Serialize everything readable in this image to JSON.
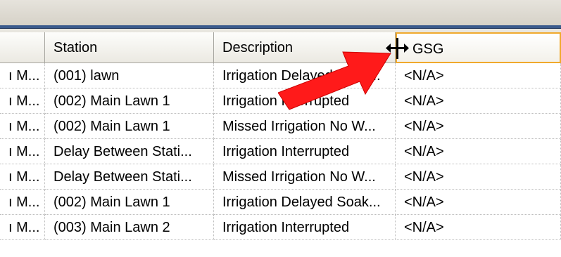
{
  "columns": {
    "col0": "",
    "station": "Station",
    "description": "Description",
    "gsg": "GSG"
  },
  "rows": [
    {
      "c0": "ı M...",
      "station": "(001) lawn",
      "description": "Irrigation Delayed Soak...",
      "gsg": "<N/A>"
    },
    {
      "c0": "ı M...",
      "station": "(002) Main Lawn 1",
      "description": "Irrigation Interrupted",
      "gsg": "<N/A>"
    },
    {
      "c0": "ı M...",
      "station": "(002) Main Lawn 1",
      "description": "Missed Irrigation No W...",
      "gsg": "<N/A>"
    },
    {
      "c0": "ı M...",
      "station": "Delay Between Stati...",
      "description": "Irrigation Interrupted",
      "gsg": "<N/A>"
    },
    {
      "c0": "ı M...",
      "station": "Delay Between Stati...",
      "description": "Missed Irrigation No W...",
      "gsg": "<N/A>"
    },
    {
      "c0": "ı M...",
      "station": "(002) Main Lawn 1",
      "description": "Irrigation Delayed Soak...",
      "gsg": "<N/A>"
    },
    {
      "c0": "ı M...",
      "station": "(003) Main Lawn 2",
      "description": "Irrigation Interrupted",
      "gsg": "<N/A>"
    }
  ],
  "annotation": {
    "arrow_color": "#ff0000",
    "cursor": "column-resize-cursor-icon"
  },
  "colors": {
    "active_header_border": "#f0a92c",
    "top_band": "#3a5a8c"
  }
}
